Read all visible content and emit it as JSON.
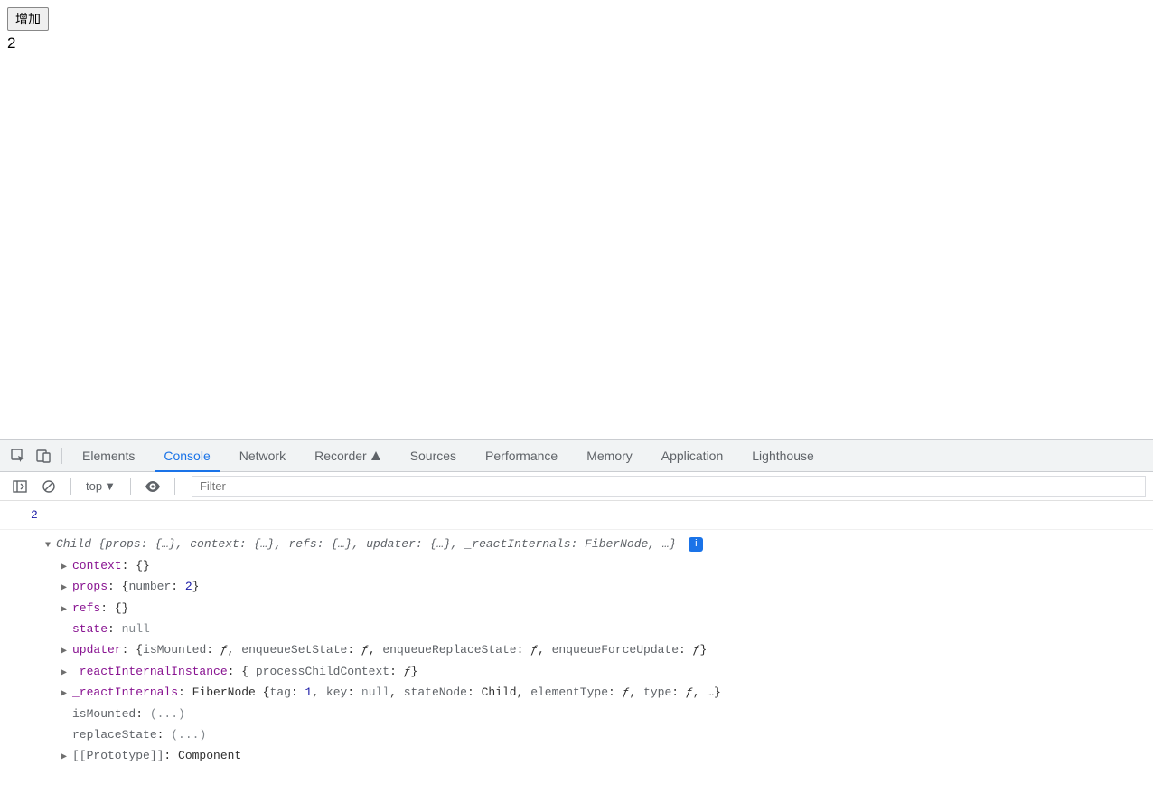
{
  "page": {
    "button_label": "增加",
    "number": "2"
  },
  "devtools": {
    "tabs": {
      "elements": "Elements",
      "console": "Console",
      "network": "Network",
      "recorder": "Recorder",
      "sources": "Sources",
      "performance": "Performance",
      "memory": "Memory",
      "application": "Application",
      "lighthouse": "Lighthouse"
    },
    "console_bar": {
      "context": "top",
      "filter_placeholder": "Filter"
    },
    "log": {
      "first_value": "2",
      "header_prefix": "Child ",
      "header_summary": "{props: {…}, context: {…}, refs: {…}, updater: {…}, _reactInternals: FiberNode, …}",
      "info_badge": "i",
      "props": {
        "context": {
          "key": "context",
          "val": "{}"
        },
        "props": {
          "key": "props",
          "brace_open": "{",
          "inner_key": "number",
          "inner_val": "2",
          "brace_close": "}"
        },
        "refs": {
          "key": "refs",
          "val": "{}"
        },
        "state": {
          "key": "state",
          "val": "null"
        },
        "updater": {
          "key": "updater",
          "text_open": "{",
          "k1": "isMounted",
          "k2": "enqueueSetState",
          "k3": "enqueueReplaceState",
          "k4": "enqueueForceUpdate",
          "f": "ƒ",
          "text_close": "}"
        },
        "reactInternalInstance": {
          "key": "_reactInternalInstance",
          "text_open": "{",
          "k1": "_processChildContext",
          "f": "ƒ",
          "text_close": "}"
        },
        "reactInternals": {
          "key": "_reactInternals",
          "prefix": "FiberNode {",
          "k1": "tag",
          "v1": "1",
          "k2": "key",
          "v2": "null",
          "k3": "stateNode",
          "v3": "Child",
          "k4": "elementType",
          "v4": "ƒ",
          "k5": "type",
          "v5": "ƒ",
          "suffix": ", …}"
        },
        "isMounted": {
          "key": "isMounted",
          "val": "(...)"
        },
        "replaceState": {
          "key": "replaceState",
          "val": "(...)"
        },
        "prototype": {
          "key": "[[Prototype]]",
          "val": "Component"
        }
      }
    }
  }
}
